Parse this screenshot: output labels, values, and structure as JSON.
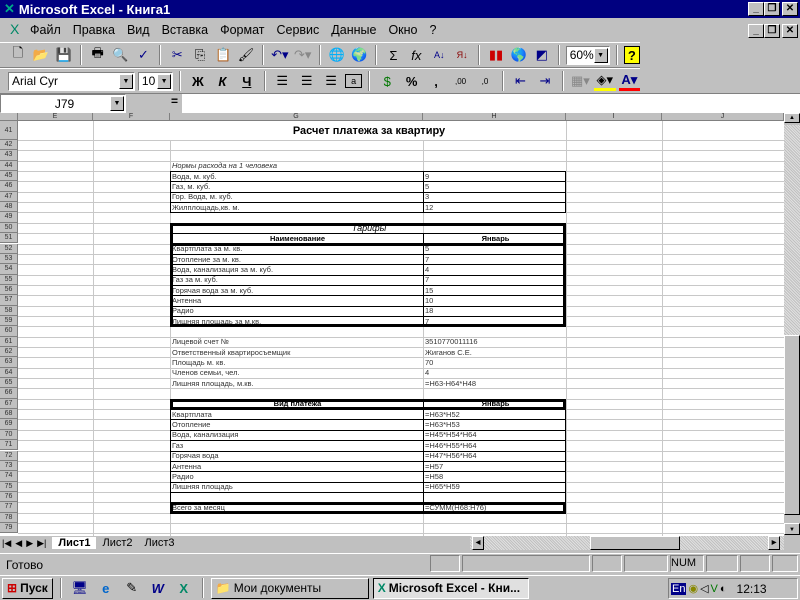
{
  "window": {
    "title": "Microsoft Excel - Книга1",
    "min": "_",
    "restore": "❐",
    "close": "✕"
  },
  "menu": [
    "Файл",
    "Правка",
    "Вид",
    "Вставка",
    "Формат",
    "Сервис",
    "Данные",
    "Окно",
    "?"
  ],
  "toolbar": {
    "zoom": "60%",
    "font": "Arial Cyr",
    "size": "10",
    "bold": "Ж",
    "italic": "К",
    "underline": "Ч",
    "percent": "%",
    "comma": ",",
    "sum": "Σ",
    "fx": "fx"
  },
  "formula_bar": {
    "name_box": "J79",
    "equals": "="
  },
  "columns": [
    {
      "id": "E"
    },
    {
      "id": "F"
    },
    {
      "id": "G"
    },
    {
      "id": "H"
    },
    {
      "id": "I"
    },
    {
      "id": "J"
    }
  ],
  "rows": [
    {
      "n": "41",
      "G": "Расчет платежа за квартиру"
    },
    {
      "n": "42"
    },
    {
      "n": "43"
    },
    {
      "n": "44",
      "G": "Нормы расхода на 1 человека"
    },
    {
      "n": "45",
      "G": "Вода, м. куб.",
      "H": "9"
    },
    {
      "n": "46",
      "G": "Газ, м. куб.",
      "H": "5"
    },
    {
      "n": "47",
      "G": "Гор. Вода, м. куб.",
      "H": "3"
    },
    {
      "n": "48",
      "G": "Жилплощадь,кв. м.",
      "H": "12"
    },
    {
      "n": "49"
    },
    {
      "n": "50",
      "G": "Тарифы"
    },
    {
      "n": "51",
      "G": "Наименование",
      "H": "Январь"
    },
    {
      "n": "52",
      "G": "Квартплата за м. кв.",
      "H": "5"
    },
    {
      "n": "53",
      "G": "Отопление за м. кв.",
      "H": "7"
    },
    {
      "n": "54",
      "G": "Вода, канализация за м. куб.",
      "H": "4"
    },
    {
      "n": "55",
      "G": "Газ за м. куб.",
      "H": "7"
    },
    {
      "n": "56",
      "G": "Горячая вода за м. куб.",
      "H": "15"
    },
    {
      "n": "57",
      "G": "Антенна",
      "H": "10"
    },
    {
      "n": "58",
      "G": "Радио",
      "H": "18"
    },
    {
      "n": "59",
      "G": "Лишняя площадь за м.кв.",
      "H": "7"
    },
    {
      "n": "60"
    },
    {
      "n": "61",
      "G": "Лицевой счет №",
      "H": "3510770011116"
    },
    {
      "n": "62",
      "G": "Ответственный квартиросъемщик",
      "H": "Жиганов С.Е."
    },
    {
      "n": "63",
      "G": "Площадь м. кв.",
      "H": "70"
    },
    {
      "n": "64",
      "G": "Членов семьи, чел.",
      "H": "4"
    },
    {
      "n": "65",
      "G": "Лишняя площадь, м.кв.",
      "H": "=H63-H64*H48"
    },
    {
      "n": "66"
    },
    {
      "n": "67",
      "G": "Вид платежа",
      "H": "Январь"
    },
    {
      "n": "68",
      "G": "Квартплата",
      "H": "=H63*H52"
    },
    {
      "n": "69",
      "G": "Отопление",
      "H": "=H63*H53"
    },
    {
      "n": "70",
      "G": "Вода, канализация",
      "H": "=H45*H54*H64"
    },
    {
      "n": "71",
      "G": "Газ",
      "H": "=H46*H55*H64"
    },
    {
      "n": "72",
      "G": "Горячая вода",
      "H": "=H47*H56*H64"
    },
    {
      "n": "73",
      "G": "Антенна",
      "H": "=H57"
    },
    {
      "n": "74",
      "G": "Радио",
      "H": "=H58"
    },
    {
      "n": "75",
      "G": "Лишняя площадь",
      "H": "=H65*H59"
    },
    {
      "n": "76"
    },
    {
      "n": "77",
      "G": "Всего за месяц",
      "H": "=СУММ(H68:H76)"
    },
    {
      "n": "78"
    },
    {
      "n": "79"
    }
  ],
  "sheets": [
    "Лист1",
    "Лист2",
    "Лист3"
  ],
  "status": {
    "text": "Готово",
    "num": "NUM"
  },
  "taskbar": {
    "start": "Пуск",
    "items": [
      "Мои документы",
      "Microsoft Excel - Кни..."
    ],
    "lang": "En",
    "clock": "12:13"
  }
}
